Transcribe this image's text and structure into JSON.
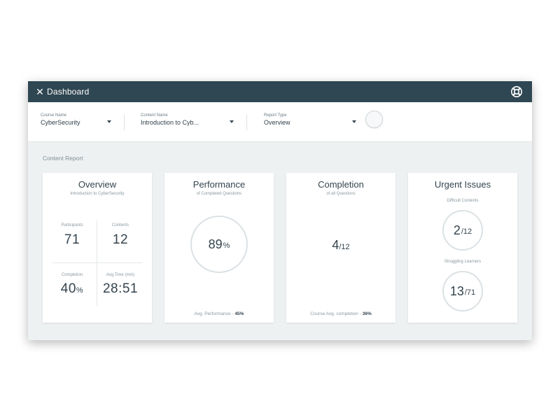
{
  "header": {
    "title": "Dashboard",
    "close_symbol": "✕",
    "close_icon": "close-icon",
    "help_icon": "lifebuoy-icon",
    "background": "#2f4752"
  },
  "filters": [
    {
      "label": "Course Name",
      "value": "CyberSecurity"
    },
    {
      "label": "Content Name",
      "value": "Introduction to Cyb..."
    },
    {
      "label": "Report Type",
      "value": "Overview"
    }
  ],
  "section_label": "Content Report",
  "overview": {
    "title": "Overview",
    "subtitle": "Introduction to CyberSecurity",
    "participants": {
      "label": "Participants",
      "value": "71"
    },
    "contents": {
      "label": "Contents",
      "value": "12"
    },
    "completion": {
      "label": "Completion",
      "value": "40",
      "unit": "%"
    },
    "avg_time": {
      "label": "Avg.Time (min)",
      "value": "28:51"
    }
  },
  "performance": {
    "title": "Performance",
    "subtitle": "of Completed Questions",
    "value": "89",
    "unit": "%",
    "footer_label": "Avg. Performance -",
    "footer_value": "45%"
  },
  "completion": {
    "title": "Completion",
    "subtitle": "of all Questions",
    "value": "4",
    "total": "/12",
    "footer_label": "Course Avg. completion -",
    "footer_value": "36%"
  },
  "urgent": {
    "title": "Urgent Issues",
    "difficult": {
      "label": "Difficult Contents",
      "value": "2",
      "total": "/12"
    },
    "struggling": {
      "label": "Struggling Learners",
      "value": "13",
      "total": "/71"
    }
  }
}
